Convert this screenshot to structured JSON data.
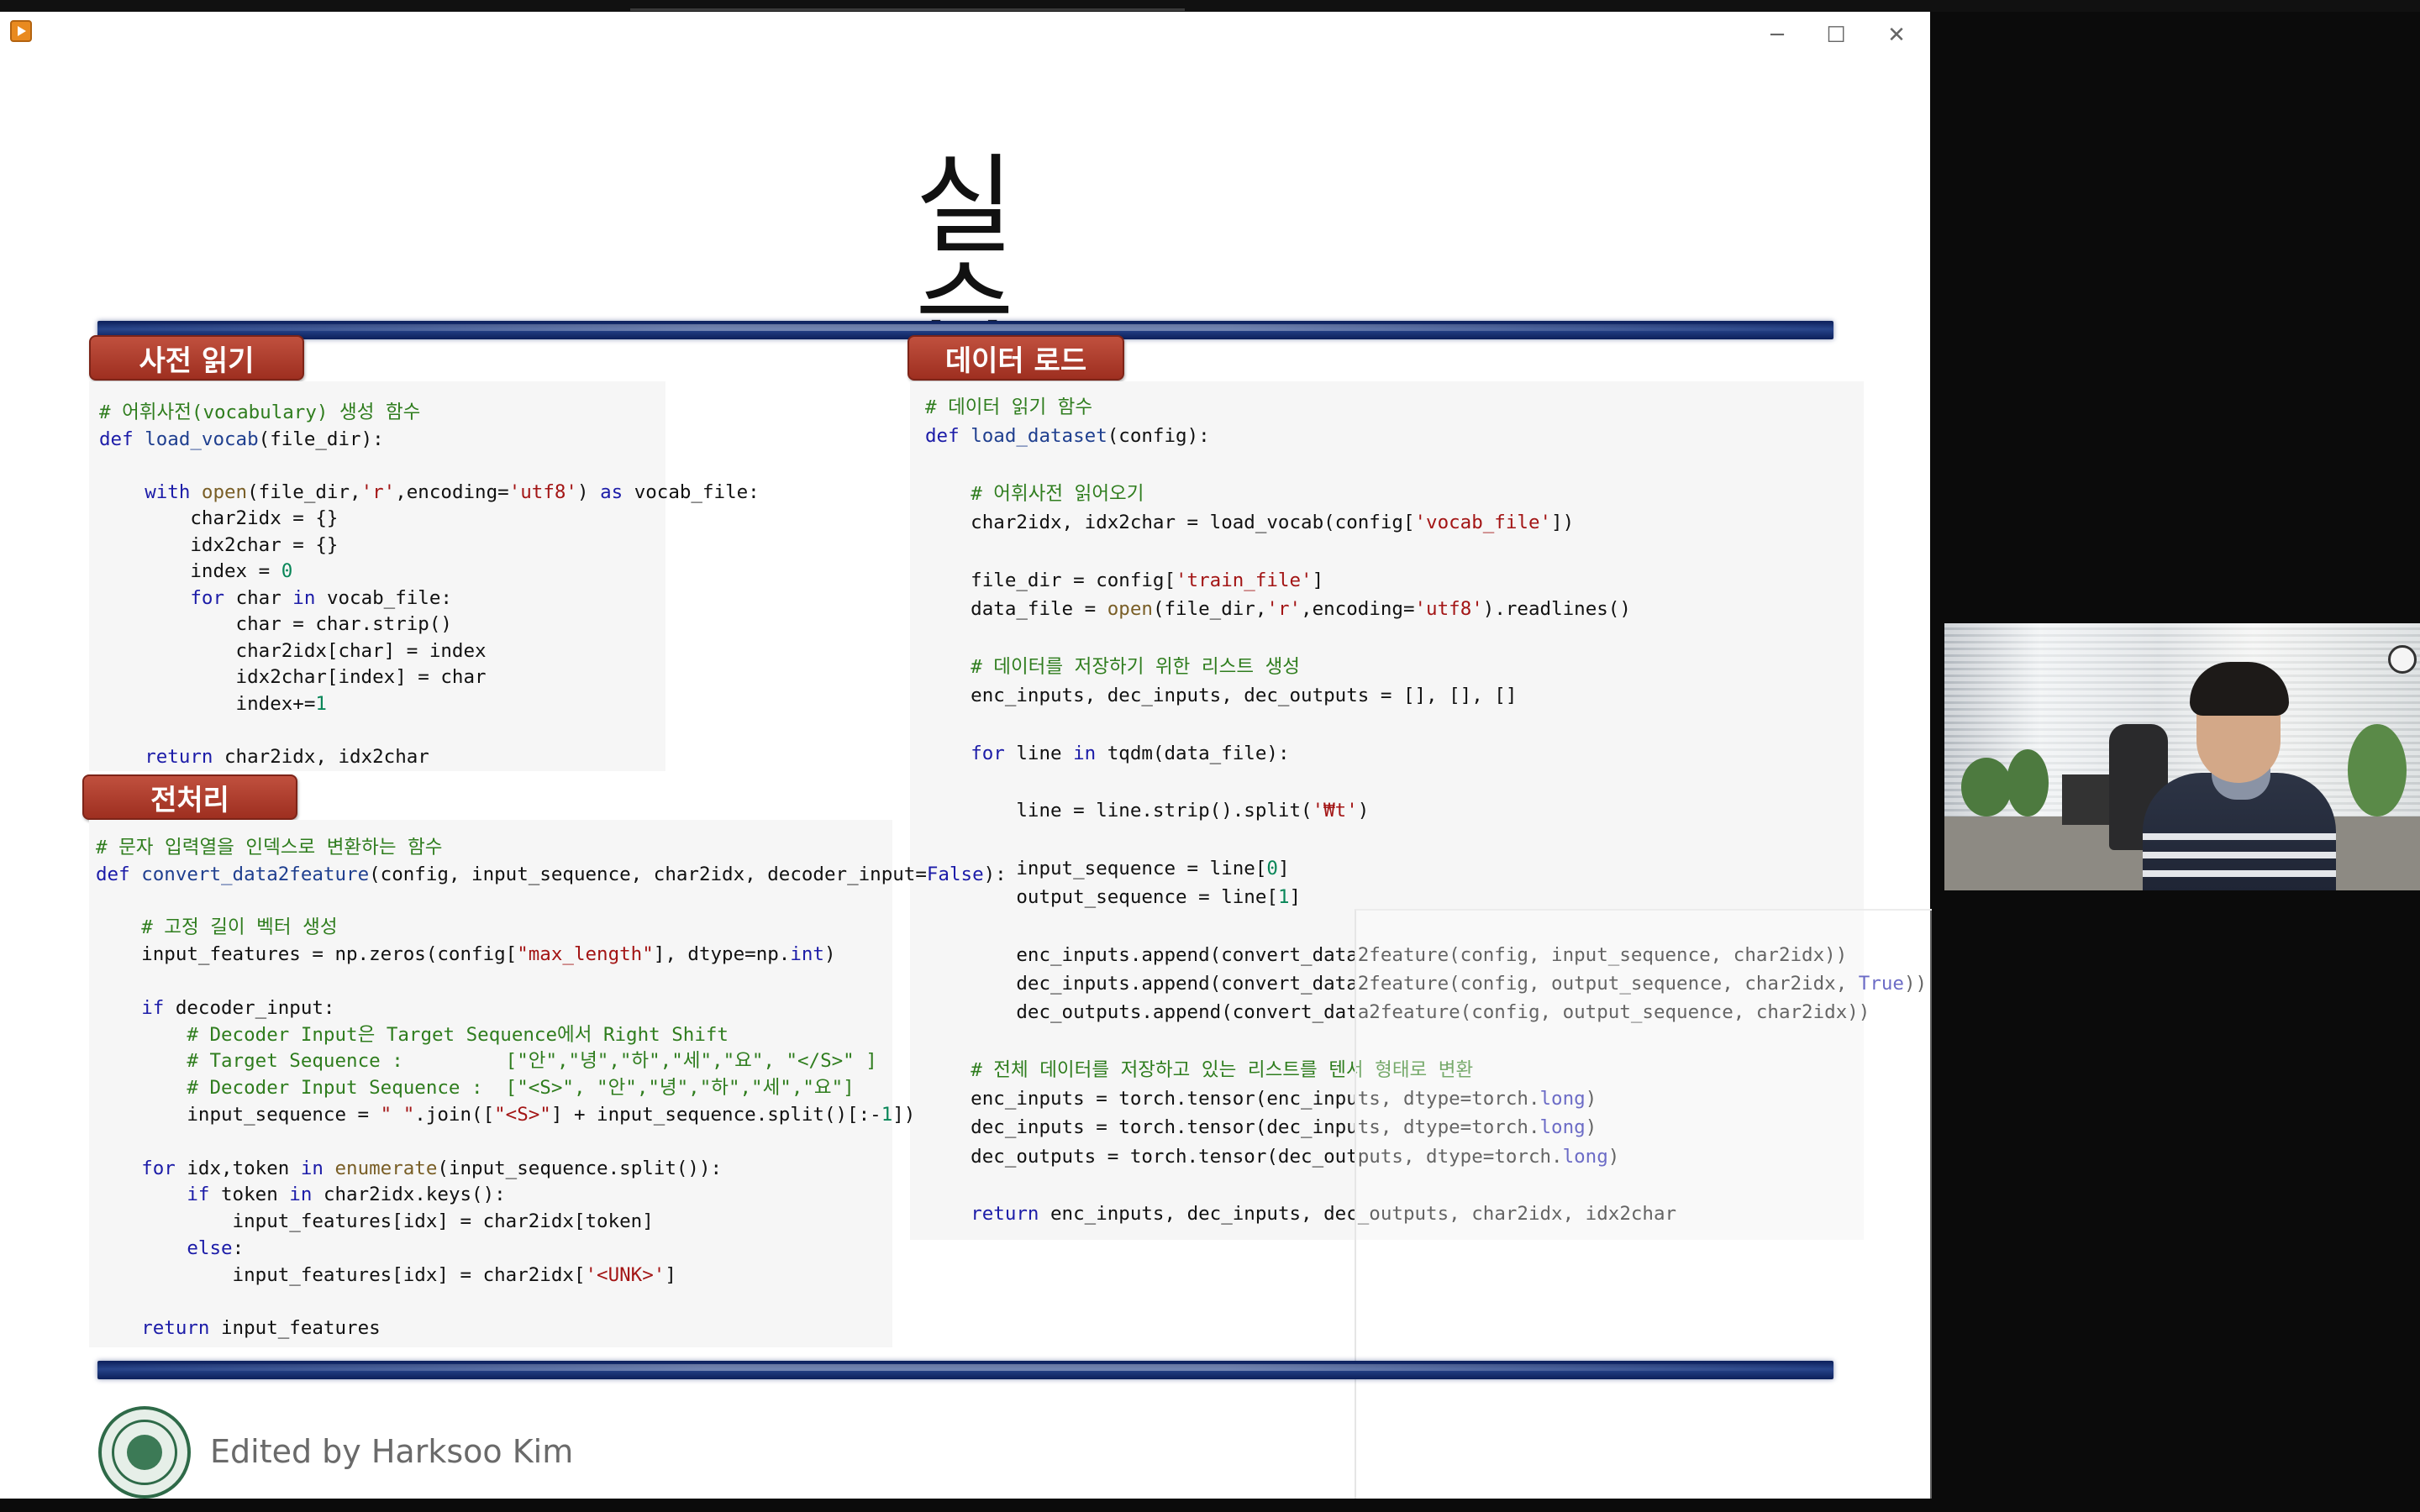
{
  "window": {
    "controls": {
      "minimize": "─",
      "maximize": "☐",
      "close": "✕"
    }
  },
  "slide": {
    "title": "실습",
    "sections": {
      "vocab": {
        "label": "사전 읽기",
        "code": [
          [
            [
              "# 어휘사전(vocabulary) 생성 함수",
              "cm"
            ]
          ],
          [
            [
              "def ",
              "kw"
            ],
            [
              "load_vocab",
              "fn"
            ],
            [
              "(file_dir):",
              ""
            ]
          ],
          [
            [
              "",
              ""
            ]
          ],
          [
            [
              "    ",
              ""
            ],
            [
              "with ",
              "kw"
            ],
            [
              "open",
              "bi"
            ],
            [
              "(file_dir,",
              ""
            ],
            [
              "'r'",
              "st"
            ],
            [
              ",encoding=",
              ""
            ],
            [
              "'utf8'",
              "st"
            ],
            [
              ") ",
              ""
            ],
            [
              "as ",
              "kw"
            ],
            [
              "vocab_file:",
              ""
            ]
          ],
          [
            [
              "        char2idx = {}",
              ""
            ]
          ],
          [
            [
              "        idx2char = {}",
              ""
            ]
          ],
          [
            [
              "        index = ",
              ""
            ],
            [
              "0",
              "num"
            ]
          ],
          [
            [
              "        ",
              ""
            ],
            [
              "for ",
              "kw"
            ],
            [
              "char ",
              ""
            ],
            [
              "in ",
              "kw"
            ],
            [
              "vocab_file:",
              ""
            ]
          ],
          [
            [
              "            char = char.strip()",
              ""
            ]
          ],
          [
            [
              "            char2idx[char] = index",
              ""
            ]
          ],
          [
            [
              "            idx2char[index] = char",
              ""
            ]
          ],
          [
            [
              "            index+=",
              ""
            ],
            [
              "1",
              "num"
            ]
          ],
          [
            [
              "",
              ""
            ]
          ],
          [
            [
              "    ",
              ""
            ],
            [
              "return ",
              "kw"
            ],
            [
              "char2idx, idx2char",
              ""
            ]
          ]
        ]
      },
      "load": {
        "label": "데이터 로드",
        "code": [
          [
            [
              "# 데이터 읽기 함수",
              "cm"
            ]
          ],
          [
            [
              "def ",
              "kw"
            ],
            [
              "load_dataset",
              "fn"
            ],
            [
              "(config):",
              ""
            ]
          ],
          [
            [
              "",
              ""
            ]
          ],
          [
            [
              "    ",
              ""
            ],
            [
              "# 어휘사전 읽어오기",
              "cm"
            ]
          ],
          [
            [
              "    char2idx, idx2char = load_vocab(config[",
              ""
            ],
            [
              "'vocab_file'",
              "st"
            ],
            [
              "])",
              ""
            ]
          ],
          [
            [
              "",
              ""
            ]
          ],
          [
            [
              "    file_dir = config[",
              ""
            ],
            [
              "'train_file'",
              "st"
            ],
            [
              "]",
              ""
            ]
          ],
          [
            [
              "    data_file = ",
              ""
            ],
            [
              "open",
              "bi"
            ],
            [
              "(file_dir,",
              ""
            ],
            [
              "'r'",
              "st"
            ],
            [
              ",encoding=",
              ""
            ],
            [
              "'utf8'",
              "st"
            ],
            [
              ").readlines()",
              ""
            ]
          ],
          [
            [
              "",
              ""
            ]
          ],
          [
            [
              "    ",
              ""
            ],
            [
              "# 데이터를 저장하기 위한 리스트 생성",
              "cm"
            ]
          ],
          [
            [
              "    enc_inputs, dec_inputs, dec_outputs = [], [], []",
              ""
            ]
          ],
          [
            [
              "",
              ""
            ]
          ],
          [
            [
              "    ",
              ""
            ],
            [
              "for ",
              "kw"
            ],
            [
              "line ",
              ""
            ],
            [
              "in ",
              "kw"
            ],
            [
              "tqdm(data_file):",
              ""
            ]
          ],
          [
            [
              "",
              ""
            ]
          ],
          [
            [
              "        line = line.strip().split(",
              ""
            ],
            [
              "'₩t'",
              "st"
            ],
            [
              ")",
              ""
            ]
          ],
          [
            [
              "",
              ""
            ]
          ],
          [
            [
              "        input_sequence = line[",
              ""
            ],
            [
              "0",
              "num"
            ],
            [
              "]",
              ""
            ]
          ],
          [
            [
              "        output_sequence = line[",
              ""
            ],
            [
              "1",
              "num"
            ],
            [
              "]",
              ""
            ]
          ],
          [
            [
              "",
              ""
            ]
          ],
          [
            [
              "        enc_inputs.append(convert_data2feature(config, input_sequence, char2idx))",
              ""
            ]
          ],
          [
            [
              "        dec_inputs.append(convert_data2feature(config, output_sequence, char2idx, ",
              ""
            ],
            [
              "True",
              "kw"
            ],
            [
              "))",
              ""
            ]
          ],
          [
            [
              "        dec_outputs.append(convert_data2feature(config, output_sequence, char2idx))",
              ""
            ]
          ],
          [
            [
              "",
              ""
            ]
          ],
          [
            [
              "    ",
              ""
            ],
            [
              "# 전체 데이터를 저장하고 있는 리스트를 텐서 형태로 변환",
              "cm"
            ]
          ],
          [
            [
              "    enc_inputs = torch.tensor(enc_inputs, dtype=torch.",
              ""
            ],
            [
              "long",
              "kw"
            ],
            [
              ")",
              ""
            ]
          ],
          [
            [
              "    dec_inputs = torch.tensor(dec_inputs, dtype=torch.",
              ""
            ],
            [
              "long",
              "kw"
            ],
            [
              ")",
              ""
            ]
          ],
          [
            [
              "    dec_outputs = torch.tensor(dec_outputs, dtype=torch.",
              ""
            ],
            [
              "long",
              "kw"
            ],
            [
              ")",
              ""
            ]
          ],
          [
            [
              "",
              ""
            ]
          ],
          [
            [
              "    ",
              ""
            ],
            [
              "return ",
              "kw"
            ],
            [
              "enc_inputs, dec_inputs, dec_outputs, char2idx, idx2char",
              ""
            ]
          ]
        ]
      },
      "preprocess": {
        "label": "전처리",
        "code": [
          [
            [
              "# 문자 입력열을 인덱스로 변환하는 함수",
              "cm"
            ]
          ],
          [
            [
              "def ",
              "kw"
            ],
            [
              "convert_data2feature",
              "fn"
            ],
            [
              "(config, input_sequence, char2idx, decoder_input=",
              ""
            ],
            [
              "False",
              "kw"
            ],
            [
              "):",
              ""
            ]
          ],
          [
            [
              "",
              ""
            ]
          ],
          [
            [
              "    ",
              ""
            ],
            [
              "# 고정 길이 벡터 생성",
              "cm"
            ]
          ],
          [
            [
              "    input_features = np.zeros(config[",
              ""
            ],
            [
              "\"max_length\"",
              "st"
            ],
            [
              "], dtype=np.",
              ""
            ],
            [
              "int",
              "kw"
            ],
            [
              ")",
              ""
            ]
          ],
          [
            [
              "",
              ""
            ]
          ],
          [
            [
              "    ",
              ""
            ],
            [
              "if ",
              "kw"
            ],
            [
              "decoder_input:",
              ""
            ]
          ],
          [
            [
              "        ",
              ""
            ],
            [
              "# Decoder Input은 Target Sequence에서 Right Shift",
              "cm"
            ]
          ],
          [
            [
              "        ",
              ""
            ],
            [
              "# Target Sequence :         [\"안\",\"녕\",\"하\",\"세\",\"요\", \"</S>\" ]",
              "cm"
            ]
          ],
          [
            [
              "        ",
              ""
            ],
            [
              "# Decoder Input Sequence :  [\"<S>\", \"안\",\"녕\",\"하\",\"세\",\"요\"]",
              "cm"
            ]
          ],
          [
            [
              "        input_sequence = ",
              ""
            ],
            [
              "\" \"",
              "st"
            ],
            [
              ".join([",
              ""
            ],
            [
              "\"<S>\"",
              "st"
            ],
            [
              "] + input_sequence.split()[:-",
              ""
            ],
            [
              "1",
              "num"
            ],
            [
              "])",
              ""
            ]
          ],
          [
            [
              "",
              ""
            ]
          ],
          [
            [
              "    ",
              ""
            ],
            [
              "for ",
              "kw"
            ],
            [
              "idx,token ",
              ""
            ],
            [
              "in ",
              "kw"
            ],
            [
              "enumerate",
              "bi"
            ],
            [
              "(input_sequence.split()):",
              ""
            ]
          ],
          [
            [
              "        ",
              ""
            ],
            [
              "if ",
              "kw"
            ],
            [
              "token ",
              ""
            ],
            [
              "in ",
              "kw"
            ],
            [
              "char2idx.keys():",
              ""
            ]
          ],
          [
            [
              "            input_features[idx] = char2idx[token]",
              ""
            ]
          ],
          [
            [
              "        ",
              ""
            ],
            [
              "else",
              "kw"
            ],
            [
              ":",
              ""
            ]
          ],
          [
            [
              "            input_features[idx] = char2idx[",
              ""
            ],
            [
              "'<UNK>'",
              "st"
            ],
            [
              "]",
              ""
            ]
          ],
          [
            [
              "",
              ""
            ]
          ],
          [
            [
              "    ",
              ""
            ],
            [
              "return ",
              "kw"
            ],
            [
              "input_features",
              ""
            ]
          ]
        ]
      }
    },
    "footer": {
      "credit": "Edited by Harksoo Kim"
    }
  },
  "colors": {
    "comment": "#2f7d1e",
    "keyword": "#1c1ca8",
    "string": "#a31515",
    "number": "#098658",
    "builtin": "#795e26",
    "funcname": "#1f3f8f",
    "section_label": "#a83a2b",
    "rule": "#1a2f6e"
  },
  "icons": {
    "app": "media-player-icon",
    "logo": "university-seal-icon"
  }
}
